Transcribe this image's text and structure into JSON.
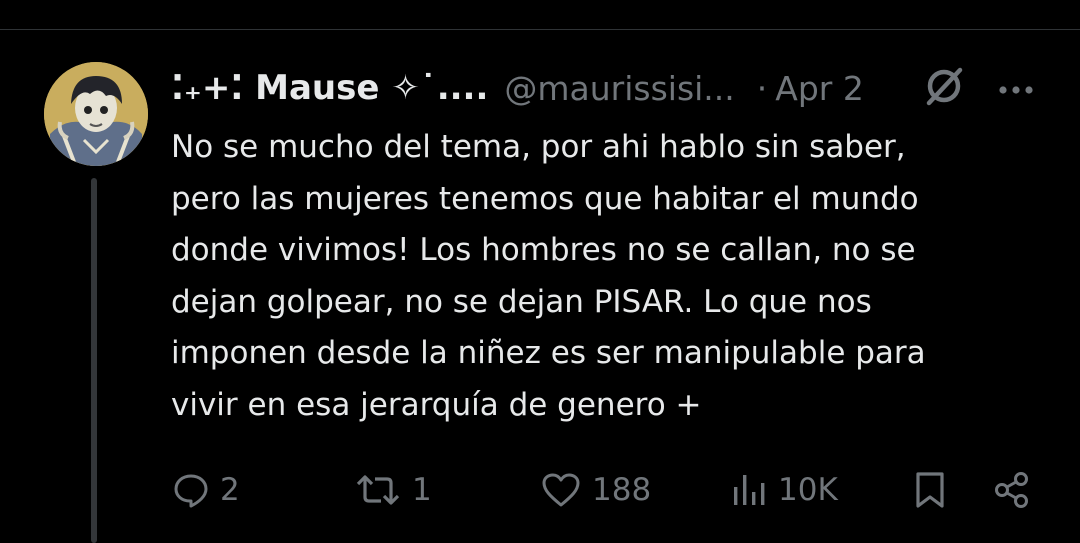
{
  "tweet": {
    "display_name": "⁚₊+⁚ Mause ✧˙....",
    "handle": "@maurissisi...",
    "separator": "·",
    "date": "Apr 2",
    "text": "No se mucho del tema, por ahi hablo sin saber,\npero las mujeres tenemos que habitar el mundo\ndonde vivimos! Los hombres no se callan, no se\ndejan golpear, no se dejan PISAR. Lo que nos\nimponen desde la niñez es ser manipulable para\nvivir en esa jerarquía de genero +"
  },
  "actions": {
    "replies": "2",
    "reposts": "1",
    "likes": "188",
    "views": "10K"
  },
  "icons": {
    "reply": "reply-bubble-icon",
    "repost": "repost-arrows-icon",
    "like": "heart-icon",
    "views": "views-bars-icon",
    "bookmark": "bookmark-icon",
    "share": "share-icon",
    "grok": "grok-icon",
    "more": "more-dots-icon"
  },
  "colors": {
    "background": "#000000",
    "text": "#e7e9ea",
    "muted": "#71767b",
    "divider": "#2f3336"
  }
}
